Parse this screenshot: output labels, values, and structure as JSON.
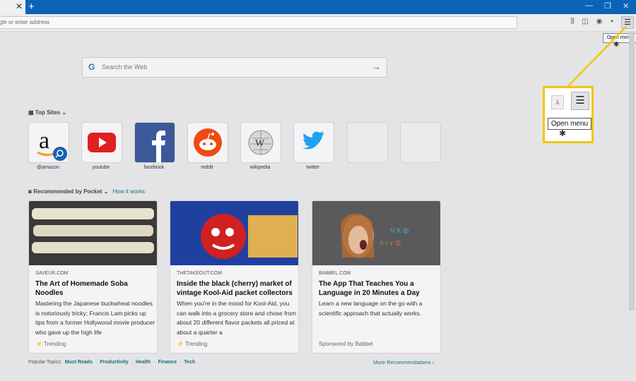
{
  "browser": {
    "tab_close": "✕",
    "new_tab": "+",
    "url_placeholder": "gle or enter address",
    "menu_icon": "☰",
    "tooltip": "Open menu"
  },
  "search": {
    "google_g": "G",
    "placeholder": "Search the Web"
  },
  "top_sites": {
    "title": "Top Sites",
    "tiles": [
      {
        "label": "@amazon"
      },
      {
        "label": "youtube"
      },
      {
        "label": "facebook"
      },
      {
        "label": "reddit"
      },
      {
        "label": "wikipedia"
      },
      {
        "label": "twitter"
      },
      {
        "label": ""
      },
      {
        "label": ""
      }
    ]
  },
  "pocket": {
    "title": "Recommended by Pocket",
    "how_it_works": "How it works",
    "cards": [
      {
        "source": "SAVEUR.COM",
        "title": "The Art of Homemade Soba Noodles",
        "desc": "Mastering the Japanese buckwheat noodles is notoriously tricky; Francis Lam picks up tips from a former Hollywood movie producer who gave up the high life",
        "footer": "Trending"
      },
      {
        "source": "THETAKEOUT.COM",
        "title": "Inside the black (cherry) market of vintage Kool-Aid packet collectors",
        "desc": "When you're in the mood for Kool-Aid, you can walk into a grocery store and chose from about 20 different flavor packets all priced at about a quarter a",
        "footer": "Trending"
      },
      {
        "source": "BABBEL.COM",
        "title": "The App That Teaches You a Language in 20 Minutes a Day",
        "desc": "Learn a new language on the go with a scientific approach that actually works.",
        "footer": "Sponsored by Babbel"
      }
    ]
  },
  "popular": {
    "label": "Popular Topics:",
    "topics": [
      "Must Reads",
      "Productivity",
      "Health",
      "Finance",
      "Tech"
    ]
  },
  "more_recommendations": "More Recommendations",
  "callout": {
    "tooltip": "Open menu",
    "menu_icon": "☰"
  },
  "colors": {
    "tabbar": "#0a64b8",
    "highlight": "#f4c500",
    "link": "#1a6e80"
  }
}
